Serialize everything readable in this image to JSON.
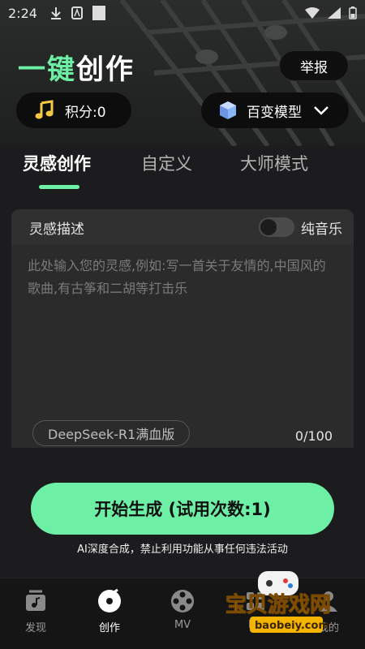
{
  "status_bar": {
    "time": "2:24"
  },
  "header": {
    "title_accent": "一键",
    "title_rest": "创作",
    "report_label": "举报"
  },
  "points": {
    "label": "积分:0",
    "icon": "music-note-icon"
  },
  "model": {
    "label": "百变模型",
    "icon": "cube-icon"
  },
  "tabs": [
    {
      "label": "灵感创作",
      "active": true
    },
    {
      "label": "自定义",
      "active": false
    },
    {
      "label": "大师模式",
      "active": false
    }
  ],
  "editor": {
    "label": "灵感描述",
    "pure_music_label": "纯音乐",
    "pure_music_on": false,
    "placeholder": "此处输入您的灵感,例如:写一首关于友情的,中国风的歌曲,有古筝和二胡等打击乐",
    "engine": "DeepSeek-R1满血版",
    "counter": "0/100"
  },
  "actions": {
    "generate_label": "开始生成 (试用次数:1)",
    "disclaimer": "AI深度合成，禁止利用功能从事任何违法活动"
  },
  "bottom_nav": [
    {
      "label": "发现",
      "icon": "music-box-icon",
      "active": false
    },
    {
      "label": "创作",
      "icon": "vinyl-disc-icon",
      "active": true
    },
    {
      "label": "MV",
      "icon": "film-reel-icon",
      "active": false
    },
    {
      "label": "De",
      "icon": "apps-icon",
      "active": false
    },
    {
      "label": "我的",
      "icon": "user-icon",
      "active": false
    }
  ],
  "watermark": {
    "text": "宝贝游戏网",
    "url_text": "baobeiy.com"
  },
  "colors": {
    "accent": "#6df0a5",
    "background": "#1c1c1e"
  }
}
